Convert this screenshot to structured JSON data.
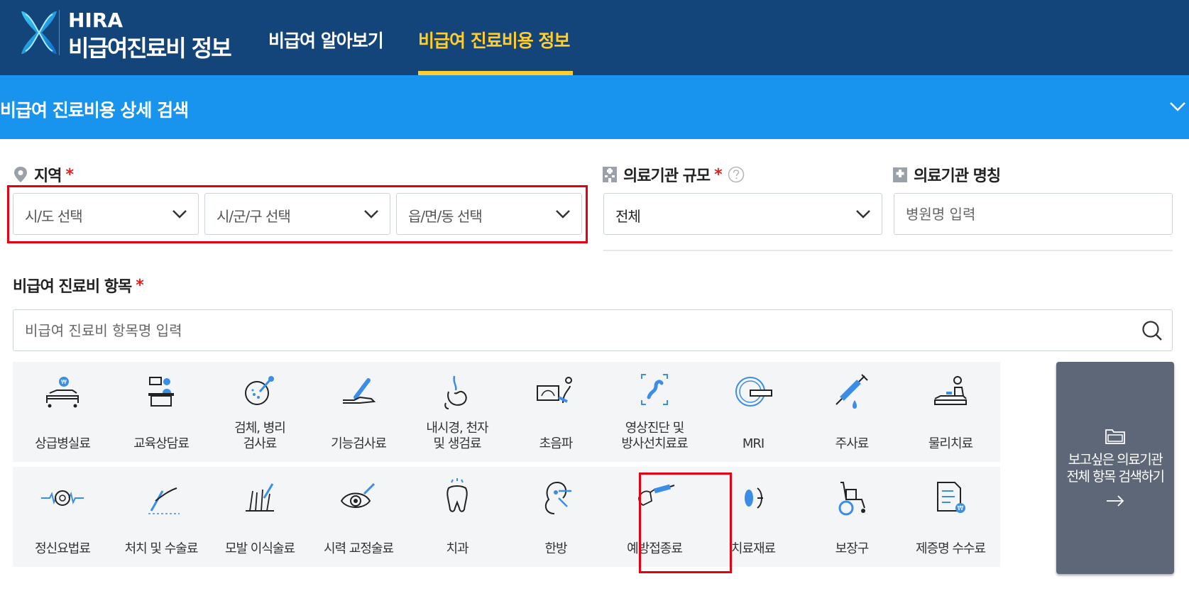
{
  "header": {
    "brand_line1": "HIRA",
    "brand_line2": "비급여진료비 정보",
    "nav": [
      {
        "label": "비급여 알아보기",
        "active": false
      },
      {
        "label": "비급여 진료비용 정보",
        "active": true
      }
    ],
    "colors": {
      "bg": "#13457a",
      "active": "#ffcd2c"
    }
  },
  "section": {
    "title": "비급여 진료비용 상세 검색",
    "toggle_icon": "chevron-down-icon",
    "color": "#1893ee"
  },
  "filters": {
    "region": {
      "label": "지역",
      "required": "*",
      "icon": "location-pin-icon",
      "selects": [
        "시/도 선택",
        "시/군/구 선택",
        "읍/면/동 선택"
      ]
    },
    "scale": {
      "label": "의료기관 규모",
      "required": "*",
      "icon": "hospital-building-icon",
      "help_icon": "question-circle-icon",
      "selected": "전체"
    },
    "name": {
      "label": "의료기관 명칭",
      "icon": "hospital-cross-icon",
      "placeholder": "병원명 입력"
    }
  },
  "items": {
    "label": "비급여 진료비 항목",
    "required": "*",
    "search_placeholder": "비급여 진료비 항목명 입력",
    "search_icon": "search-icon",
    "categories": [
      {
        "label": "상급병실료",
        "icon": "hospital-bed-icon"
      },
      {
        "label": "교육상담료",
        "icon": "counseling-desk-icon"
      },
      {
        "label": "검체, 병리\n검사료",
        "icon": "specimen-test-icon"
      },
      {
        "label": "기능검사료",
        "icon": "function-test-icon"
      },
      {
        "label": "내시경, 천자\n및 생검료",
        "icon": "endoscope-icon"
      },
      {
        "label": "초음파",
        "icon": "ultrasound-icon"
      },
      {
        "label": "영상진단 및\n방사선치료료",
        "icon": "xray-icon"
      },
      {
        "label": "MRI",
        "icon": "mri-icon"
      },
      {
        "label": "주사료",
        "icon": "syringe-icon"
      },
      {
        "label": "물리치료",
        "icon": "physical-therapy-icon"
      },
      {
        "label": "정신요법료",
        "icon": "brain-wave-icon"
      },
      {
        "label": "처치 및 수술료",
        "icon": "scalpel-icon"
      },
      {
        "label": "모발 이식술료",
        "icon": "hair-transplant-icon"
      },
      {
        "label": "시력 교정술료",
        "icon": "eye-icon"
      },
      {
        "label": "치과",
        "icon": "tooth-icon"
      },
      {
        "label": "한방",
        "icon": "acupuncture-ear-icon"
      },
      {
        "label": "예방접종료",
        "icon": "vaccine-injection-icon"
      },
      {
        "label": "치료재료",
        "icon": "lens-material-icon"
      },
      {
        "label": "보장구",
        "icon": "wheelchair-icon"
      },
      {
        "label": "제증명 수수료",
        "icon": "certificate-fee-icon"
      }
    ],
    "cta": {
      "text": "보고싶은 의료기관\n전체 항목 검색하기",
      "icon": "folder-icon",
      "arrow": "arrow-right-icon",
      "color": "#5e6777"
    }
  }
}
